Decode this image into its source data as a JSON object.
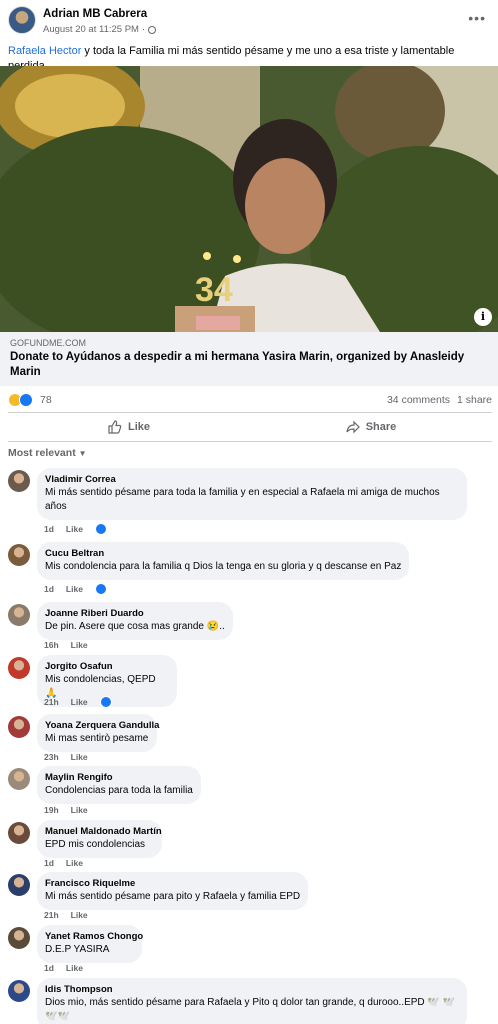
{
  "post": {
    "author": "Adrian MB Cabrera",
    "date": "August 20 at 11:25 PM",
    "separator": "·",
    "mention": "Rafaela Hector",
    "text": " y toda la Familia mi más sentido pésame y me uno a esa triste y lamentable perdida ."
  },
  "link": {
    "domain": "GOFUNDME.COM",
    "title": "Donate to Ayúdanos a despedir a mi hermana Yasira Marin, organized by Anasleidy Marin",
    "info_icon": "i"
  },
  "stats": {
    "reactions": "78",
    "comments": "34 comments",
    "shares": "1 share"
  },
  "actions": {
    "like": "Like",
    "share": "Share"
  },
  "sort_label": "Most relevant",
  "comments": [
    {
      "name": "Vladimir Correa",
      "text": "Mi más sentido pésame para toda la familia y en especial a Rafaela mi amiga de muchos años",
      "time": "1d",
      "like": "Like",
      "liked": true,
      "avatar_color": "#6b5a4e"
    },
    {
      "name": "Cucu Beltran",
      "text": "Mis condolencia para la familia q Dios la tenga en su gloria y q descanse en Paz",
      "time": "1d",
      "like": "Like",
      "liked": true,
      "avatar_color": "#7a5c3c"
    },
    {
      "name": "Joanne Riberi Duardo",
      "text": "De pin. Asere que cosa mas grande 😢..",
      "time": "16h",
      "like": "Like",
      "liked": false,
      "avatar_color": "#8a7a6a"
    },
    {
      "name": "Jorgito Osafun",
      "text": "Mis condolencias, QEPD 🙏",
      "time": "21h",
      "like": "Like",
      "liked": true,
      "avatar_color": "#c0392b"
    },
    {
      "name": "Yoana Zerquera Gandulla",
      "text": "Mi mas sentirò pesame",
      "time": "23h",
      "like": "Like",
      "liked": false,
      "avatar_color": "#a23a3a"
    },
    {
      "name": "Maylin Rengifo",
      "text": "Condolencias para toda la familia",
      "time": "19h",
      "like": "Like",
      "liked": false,
      "avatar_color": "#9a8a7a"
    },
    {
      "name": "Manuel Maldonado Martín",
      "text": "EPD mis condolencias",
      "time": "1d",
      "like": "Like",
      "liked": false,
      "avatar_color": "#6a4a3a"
    },
    {
      "name": "Francisco Riquelme",
      "text": "Mi más sentido pésame para pito y Rafaela y familia EPD",
      "time": "21h",
      "like": "Like",
      "liked": false,
      "avatar_color": "#2c3e6a"
    },
    {
      "name": "Yanet Ramos Chongo",
      "text": "D.E.P YASIRA",
      "time": "1d",
      "like": "Like",
      "liked": false,
      "avatar_color": "#5a4a3a"
    },
    {
      "name": "Idis Thompson",
      "text": "Dios mio, más sentido pésame para Rafaela y Pito q dolor tan grande, q durooo..EPD 🕊️ 🕊️🕊️🕊️",
      "time": "",
      "like": "",
      "liked": false,
      "avatar_color": "#2c4a8a"
    }
  ]
}
